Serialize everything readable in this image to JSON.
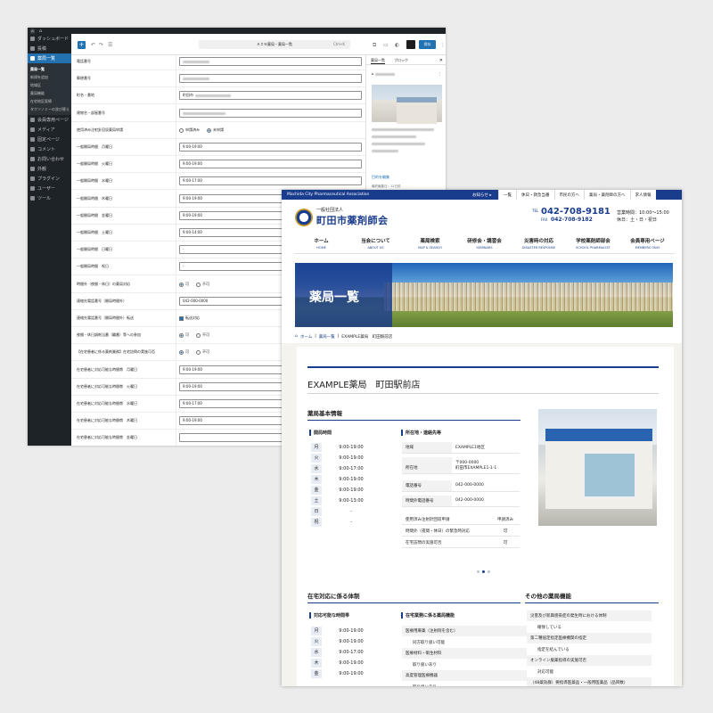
{
  "admin": {
    "menu": [
      {
        "label": "ダッシュボード",
        "icon": "dashboard-icon"
      },
      {
        "label": "投稿",
        "icon": "pin-icon"
      },
      {
        "label": "薬局一覧",
        "icon": "home-icon",
        "active": true
      },
      {
        "label": "会員専用ページ",
        "icon": "page-icon"
      },
      {
        "label": "メディア",
        "icon": "media-icon"
      },
      {
        "label": "固定ページ",
        "icon": "page-icon"
      },
      {
        "label": "コメント",
        "icon": "comment-icon"
      },
      {
        "label": "お問い合わせ",
        "icon": "mail-icon"
      },
      {
        "label": "外観",
        "icon": "brush-icon"
      },
      {
        "label": "プラグイン",
        "icon": "plugin-icon"
      },
      {
        "label": "ユーザー",
        "icon": "user-icon"
      },
      {
        "label": "ツール",
        "icon": "wrench-icon"
      }
    ],
    "submenu": [
      "薬局一覧",
      "新規を追加",
      "地域区",
      "薬局機能",
      "在宅地区医療",
      "タクソノミーの並び替え"
    ],
    "toolbar": {
      "add": "+",
      "undo": "↶",
      "redo": "↷",
      "list": "☰",
      "title": "ＡＩＮ薬局・薬局一覧",
      "shortcut": "Ctrl+K",
      "save": "保存"
    },
    "form_rows": [
      {
        "label": "電話番号",
        "type": "blur",
        "value": ""
      },
      {
        "label": "郵便番号",
        "type": "blur",
        "value": ""
      },
      {
        "label": "町名・番地",
        "type": "text",
        "value": "町田市"
      },
      {
        "label": "建物名・部屋番号",
        "type": "blur",
        "value": ""
      },
      {
        "label": "使用済み注射針回収薬局申請",
        "type": "radio",
        "options": [
          "申請済み",
          "未申請"
        ],
        "selected": 1
      },
      {
        "label": "一般開局時間　月曜日",
        "type": "text",
        "value": "9:00-19:00"
      },
      {
        "label": "一般開局時間　火曜日",
        "type": "text",
        "value": "9:00-19:00"
      },
      {
        "label": "一般開局時間　水曜日",
        "type": "text",
        "value": "9:00-17:00"
      },
      {
        "label": "一般開局時間　木曜日",
        "type": "text",
        "value": "9:00-19:00"
      },
      {
        "label": "一般開局時間　金曜日",
        "type": "text",
        "value": "9:00-19:00"
      },
      {
        "label": "一般開局時間　土曜日",
        "type": "text",
        "value": "9:00-14:00"
      },
      {
        "label": "一般開局時間　日曜日",
        "type": "text",
        "value": "-"
      },
      {
        "label": "一般開局時間　祝日",
        "type": "text",
        "value": "-"
      },
      {
        "label": "時間外（夜間・休日）の薬局対応",
        "type": "radio",
        "options": [
          "可",
          "不可"
        ],
        "selected": 0
      },
      {
        "label": "連絡先電話番号（開局時間外）",
        "type": "text",
        "value": "042-000-0000"
      },
      {
        "label": "連絡先電話番号（開局時間外）転送",
        "type": "check",
        "value": "転送対応"
      },
      {
        "label": "夜間・休日調剤当番（輪番）等への参加",
        "type": "radio",
        "options": [
          "可",
          "不可"
        ],
        "selected": 0
      },
      {
        "label": "【在宅患者に係る薬剤業務】在宅訪問の実施可否",
        "type": "radio",
        "options": [
          "可",
          "不可"
        ],
        "selected": 0
      },
      {
        "label": "在宅患者に対応可能な時間帯　月曜日",
        "type": "text",
        "value": "9:00-19:00"
      },
      {
        "label": "在宅患者に対応可能な時間帯　火曜日",
        "type": "text",
        "value": "9:00-19:00"
      },
      {
        "label": "在宅患者に対応可能な時間帯　水曜日",
        "type": "text",
        "value": "9:00-17:00"
      },
      {
        "label": "在宅患者に対応可能な時間帯　木曜日",
        "type": "text",
        "value": "9:00-19:00"
      },
      {
        "label": "在宅患者に対応可能な時間帯　金曜日",
        "type": "text",
        "value": ""
      }
    ],
    "panel": {
      "tab_page": "薬局一覧",
      "tab_block": "ブロック",
      "close": "✕",
      "link": "目的を編集",
      "meta": "最終編集日：12日前",
      "status_label": "ステータス",
      "status_value": "公開済み",
      "publish_label": "公開",
      "publish_value": "5月28日 6:10 PM"
    }
  },
  "site": {
    "org_en": "Machida City Pharmaceutical Association",
    "news": "お知らせ ▸",
    "top_links": [
      "一覧",
      "休日・救急当番",
      "市民の方へ",
      "薬局・薬剤師の方へ",
      "求人情報"
    ],
    "corp": "一般社団法人",
    "name": "町田市薬剤師会",
    "tel_label": "TEL",
    "tel": "042-708-9181",
    "fax_label": "FAX",
    "fax": "042-708-9182",
    "hours_1": "営業時間：10:00～15:00",
    "hours_2": "休日：土・日・祝日",
    "nav": [
      {
        "ja": "ホーム",
        "en": "HOME"
      },
      {
        "ja": "当会について",
        "en": "ABOUT US"
      },
      {
        "ja": "薬局検索",
        "en": "MAP & SEARCH"
      },
      {
        "ja": "研修会・講習会",
        "en": "SEMINARS"
      },
      {
        "ja": "災害時の対応",
        "en": "DISASTER RESPONSE"
      },
      {
        "ja": "学校薬剤師部会",
        "en": "SCHOOL PHARMACIST"
      },
      {
        "ja": "会員専用ページ",
        "en": "MEMBERS ONLY"
      }
    ],
    "hero_title": "薬局一覧",
    "breadcrumb": [
      "ホーム",
      "薬局一覧",
      "EXAMPLE薬局　町田駅前店"
    ],
    "store_title": "EXAMPLE薬局　町田駅前店",
    "basic_heading": "薬局基本情報",
    "hours_heading": "開局時間",
    "hours": [
      {
        "day": "月",
        "time": "9:00-19:00"
      },
      {
        "day": "火",
        "time": "9:00-19:00"
      },
      {
        "day": "水",
        "time": "9:00-17:00"
      },
      {
        "day": "木",
        "time": "9:00-19:00"
      },
      {
        "day": "金",
        "time": "9:00-19:00"
      },
      {
        "day": "土",
        "time": "9:00-13:00"
      },
      {
        "day": "日",
        "time": "-"
      },
      {
        "day": "祝",
        "time": "-"
      }
    ],
    "location_heading": "所在地・連絡先等",
    "location": [
      {
        "k": "地域",
        "v": "EXAMPLE1地区"
      },
      {
        "k": "所在地",
        "v": "〒000-0000",
        "v2": "町田市EXAMPLE1-1-1"
      },
      {
        "k": "電話番号",
        "v": "042-000-0000"
      },
      {
        "k": "時間外電話番号",
        "v": "042-000-0000"
      }
    ],
    "extras": [
      {
        "k": "使用済み注射針回収申請",
        "v": "申請済み"
      },
      {
        "k": "時間外（夜間・休日）の緊急時対応",
        "v": "可"
      },
      {
        "k": "在宅訪問の実施可否",
        "v": "可"
      }
    ],
    "home_heading": "在宅対応に係る体制",
    "home_hours_heading": "対応可能な時間帯",
    "home_hours": [
      {
        "day": "月",
        "time": "9:00-19:00"
      },
      {
        "day": "火",
        "time": "9:00-19:00"
      },
      {
        "day": "水",
        "time": "9:00-17:00"
      },
      {
        "day": "木",
        "time": "9:00-19:00"
      },
      {
        "day": "金",
        "time": "9:00-19:00"
      }
    ],
    "home_funcs_heading": "在宅業務に係る薬局機能",
    "home_funcs": [
      {
        "text": "医療用麻薬（注射剤を含む）",
        "hd": true
      },
      {
        "text": "同方取り扱い可能",
        "hd": false
      },
      {
        "text": "医療材料・衛生材料",
        "hd": true
      },
      {
        "text": "取り扱いあり",
        "hd": false
      },
      {
        "text": "高度管理医療機器",
        "hd": true
      },
      {
        "text": "取り扱いあり",
        "hd": false
      }
    ],
    "other_heading": "その他の薬局機能",
    "other_funcs": [
      {
        "text": "災害及び新興感染症の発生時における体制",
        "hd": true
      },
      {
        "text": "確保している",
        "hd": false
      },
      {
        "text": "第二種協定指定医療機関の指定",
        "hd": true
      },
      {
        "text": "指定を結んでいる",
        "hd": false
      },
      {
        "text": "オンライン服薬指導の実施可否",
        "hd": true
      },
      {
        "text": "対応可能",
        "hd": false
      },
      {
        "text": "（48薬効群）要指導医薬品・一般用医薬品（品目数）",
        "hd": true
      }
    ]
  },
  "colors": {
    "brand": "#1a3c8c",
    "admin_bar": "#1d2327",
    "wp_blue": "#2271b1"
  }
}
